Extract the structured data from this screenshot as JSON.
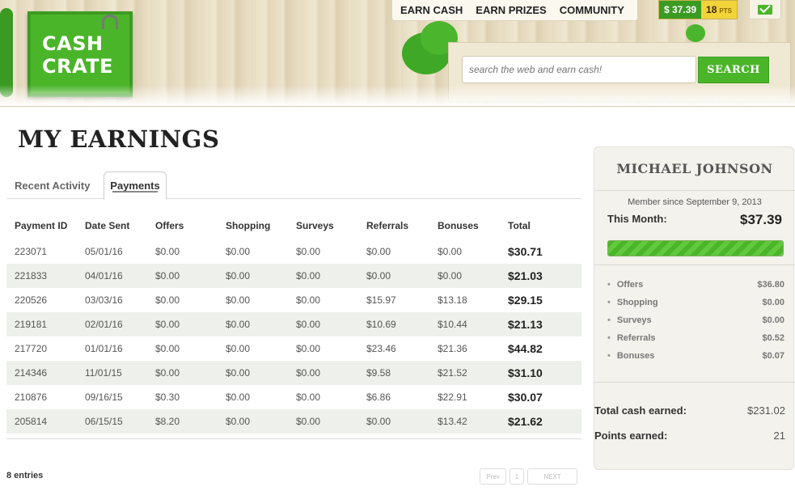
{
  "header": {
    "logo_line1": "CASH",
    "logo_line2": "CRATE",
    "nav": [
      "EARN CASH",
      "EARN PRIZES",
      "COMMUNITY"
    ],
    "balance_cash": "$ 37.39",
    "balance_points": "18",
    "points_label": "PTS",
    "search_placeholder": "search the web and earn cash!",
    "search_button": "SEARCH",
    "colors": {
      "brand_green": "#4bb52a",
      "points_yellow": "#f2d33a"
    }
  },
  "page": {
    "title": "MY EARNINGS",
    "tabs": [
      "Recent Activity",
      "Payments"
    ],
    "active_tab": "Payments"
  },
  "table": {
    "headers": [
      "Payment ID",
      "Date Sent",
      "Offers",
      "Shopping",
      "Surveys",
      "Referrals",
      "Bonuses",
      "Total"
    ],
    "rows": [
      [
        "223071",
        "05/01/16",
        "$0.00",
        "$0.00",
        "$0.00",
        "$0.00",
        "$0.00",
        "$30.71"
      ],
      [
        "221833",
        "04/01/16",
        "$0.00",
        "$0.00",
        "$0.00",
        "$0.00",
        "$0.00",
        "$21.03"
      ],
      [
        "220526",
        "03/03/16",
        "$0.00",
        "$0.00",
        "$0.00",
        "$15.97",
        "$13.18",
        "$29.15"
      ],
      [
        "219181",
        "02/01/16",
        "$0.00",
        "$0.00",
        "$0.00",
        "$10.69",
        "$10.44",
        "$21.13"
      ],
      [
        "217720",
        "01/01/16",
        "$0.00",
        "$0.00",
        "$0.00",
        "$23.46",
        "$21.36",
        "$44.82"
      ],
      [
        "214346",
        "11/01/15",
        "$0.00",
        "$0.00",
        "$0.00",
        "$9.58",
        "$21.52",
        "$31.10"
      ],
      [
        "210876",
        "09/16/15",
        "$0.30",
        "$0.00",
        "$0.00",
        "$6.86",
        "$22.91",
        "$30.07"
      ],
      [
        "205814",
        "06/15/15",
        "$8.20",
        "$0.00",
        "$0.00",
        "$0.00",
        "$13.42",
        "$21.62"
      ]
    ],
    "entries_label": "8 entries",
    "pager": {
      "prev": "Prev",
      "page": "1",
      "next": "NEXT"
    }
  },
  "sidebar": {
    "name": "MICHAEL JOHNSON",
    "member_since": "Member since September 9, 2013",
    "this_month_label": "This Month:",
    "this_month_value": "$37.39",
    "progress_fraction": 1.0,
    "breakdown": [
      {
        "label": "Offers",
        "value": "$36.80"
      },
      {
        "label": "Shopping",
        "value": "$0.00"
      },
      {
        "label": "Surveys",
        "value": "$0.00"
      },
      {
        "label": "Referrals",
        "value": "$0.52"
      },
      {
        "label": "Bonuses",
        "value": "$0.07"
      }
    ],
    "total_cash_label": "Total cash earned:",
    "total_cash_value": "$231.02",
    "points_label": "Points earned:",
    "points_value": "21"
  }
}
